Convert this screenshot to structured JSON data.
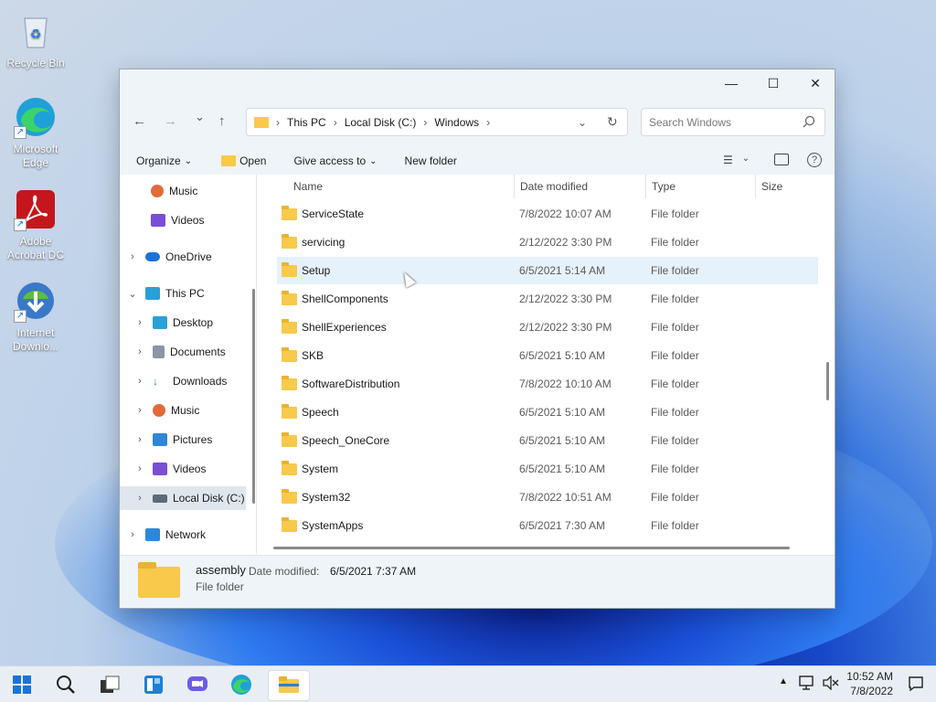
{
  "desktop": {
    "icons": [
      {
        "label": "Recycle Bin",
        "icon": "recycle-bin-icon"
      },
      {
        "label": "Microsoft Edge",
        "icon": "edge-icon"
      },
      {
        "label": "Adobe Acrobat DC",
        "icon": "acrobat-icon"
      },
      {
        "label": "Internet Downlo...",
        "icon": "idm-icon"
      }
    ]
  },
  "window": {
    "controls": {
      "minimize": "—",
      "maximize": "☐",
      "close": "✕"
    },
    "nav": {
      "back": "←",
      "forward": "→",
      "recent": "⌄",
      "up": "↑"
    },
    "breadcrumb": [
      "This PC",
      "Local Disk (C:)",
      "Windows"
    ],
    "search_placeholder": "Search Windows",
    "commands": {
      "organize": "Organize",
      "open": "Open",
      "give_access": "Give access to",
      "new_folder": "New folder"
    },
    "nav_pane": [
      {
        "label": "Music",
        "icon": "music-icon",
        "level": 2,
        "chevron": ""
      },
      {
        "label": "Videos",
        "icon": "videos-icon",
        "level": 2,
        "chevron": ""
      },
      {
        "label": "OneDrive",
        "icon": "cloud-icon",
        "level": 0,
        "chevron": "›"
      },
      {
        "label": "This PC",
        "icon": "computer-icon",
        "level": 0,
        "chevron": "⌄"
      },
      {
        "label": "Desktop",
        "icon": "desktop-icon",
        "level": 1,
        "chevron": "›"
      },
      {
        "label": "Documents",
        "icon": "documents-icon",
        "level": 1,
        "chevron": "›"
      },
      {
        "label": "Downloads",
        "icon": "downloads-icon",
        "level": 1,
        "chevron": "›"
      },
      {
        "label": "Music",
        "icon": "music-icon",
        "level": 1,
        "chevron": "›"
      },
      {
        "label": "Pictures",
        "icon": "pictures-icon",
        "level": 1,
        "chevron": "›"
      },
      {
        "label": "Videos",
        "icon": "videos-icon",
        "level": 1,
        "chevron": "›"
      },
      {
        "label": "Local Disk (C:)",
        "icon": "drive-icon",
        "level": 1,
        "chevron": "›"
      },
      {
        "label": "Network",
        "icon": "network-icon",
        "level": 0,
        "chevron": "›"
      }
    ],
    "columns": {
      "name": "Name",
      "date": "Date modified",
      "type": "Type",
      "size": "Size"
    },
    "files": [
      {
        "name": "ServiceState",
        "date": "7/8/2022 10:07 AM",
        "type": "File folder"
      },
      {
        "name": "servicing",
        "date": "2/12/2022 3:30 PM",
        "type": "File folder"
      },
      {
        "name": "Setup",
        "date": "6/5/2021 5:14 AM",
        "type": "File folder"
      },
      {
        "name": "ShellComponents",
        "date": "2/12/2022 3:30 PM",
        "type": "File folder"
      },
      {
        "name": "ShellExperiences",
        "date": "2/12/2022 3:30 PM",
        "type": "File folder"
      },
      {
        "name": "SKB",
        "date": "6/5/2021 5:10 AM",
        "type": "File folder"
      },
      {
        "name": "SoftwareDistribution",
        "date": "7/8/2022 10:10 AM",
        "type": "File folder"
      },
      {
        "name": "Speech",
        "date": "6/5/2021 5:10 AM",
        "type": "File folder"
      },
      {
        "name": "Speech_OneCore",
        "date": "6/5/2021 5:10 AM",
        "type": "File folder"
      },
      {
        "name": "System",
        "date": "6/5/2021 5:10 AM",
        "type": "File folder"
      },
      {
        "name": "System32",
        "date": "7/8/2022 10:51 AM",
        "type": "File folder"
      },
      {
        "name": "SystemApps",
        "date": "6/5/2021 7:30 AM",
        "type": "File folder"
      }
    ],
    "details": {
      "name": "assembly",
      "date_label": "Date modified:",
      "date_value": "6/5/2021 7:37 AM",
      "type": "File folder"
    }
  },
  "taskbar": {
    "time": "10:52 AM",
    "date": "7/8/2022"
  }
}
